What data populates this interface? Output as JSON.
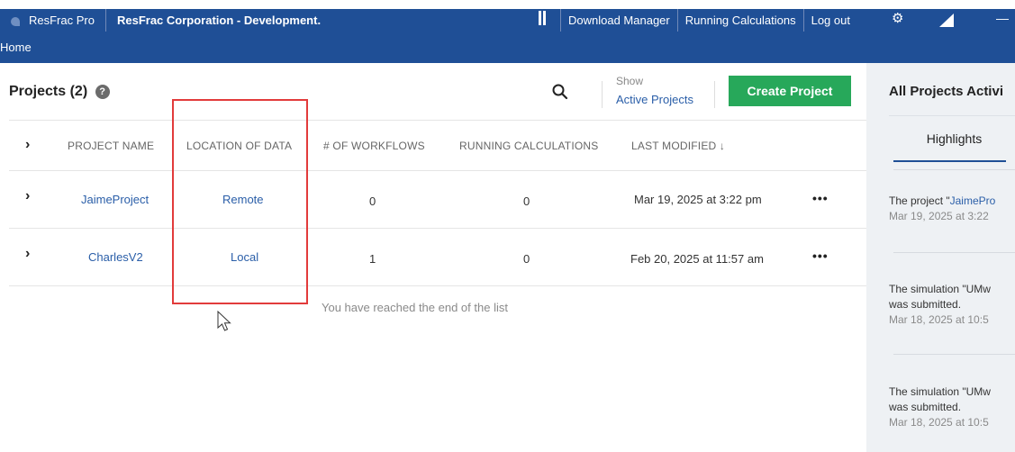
{
  "topbar": {
    "app_name": "ResFrac Pro",
    "org": "ResFrac Corporation - Development.",
    "nav": [
      "Download Manager",
      "Running Calculations",
      "Log out"
    ]
  },
  "subbar": {
    "home": "Home"
  },
  "projects": {
    "title": "Projects (2)",
    "show_label": "Show",
    "show_link": "Active Projects",
    "create_button": "Create Project"
  },
  "table": {
    "headers": [
      "PROJECT NAME",
      "LOCATION OF DATA",
      "# OF WORKFLOWS",
      "RUNNING CALCULATIONS",
      "LAST MODIFIED ↓"
    ],
    "rows": [
      {
        "name": "JaimeProject",
        "location": "Remote",
        "workflows": "0",
        "running": "0",
        "modified": "Mar 19, 2025 at 3:22 pm",
        "menu": "•••"
      },
      {
        "name": "CharlesV2",
        "location": "Local",
        "workflows": "1",
        "running": "0",
        "modified": "Feb 20, 2025 at 11:57 am",
        "menu": "•••"
      }
    ],
    "end_message": "You have reached the end of the list"
  },
  "activity": {
    "title": "All Projects Activi",
    "tab": "Highlights",
    "items": [
      {
        "line1": "The project \"",
        "line1_link": "JaimePro",
        "line2": "",
        "time": "Mar 19, 2025 at 3:22"
      },
      {
        "line1": "The simulation \"UMw",
        "line1_link": "",
        "line2": " was submitted.",
        "time": "Mar 18, 2025 at 10:5"
      },
      {
        "line1": "The simulation \"UMw",
        "line1_link": "",
        "line2": " was submitted.",
        "time": "Mar 18, 2025 at 10:5"
      }
    ]
  },
  "colors": {
    "nav_blue": "#1f4f96",
    "create_green": "#27a85a",
    "link_blue": "#2a5ea8",
    "highlight_red": "#e23b3b"
  },
  "icons": [
    "logo-icon",
    "pause-icon",
    "gear-icon",
    "triangle-icon",
    "minimize-icon",
    "help-icon",
    "search-icon",
    "chevron-right-icon",
    "more-icon",
    "cursor-icon"
  ]
}
